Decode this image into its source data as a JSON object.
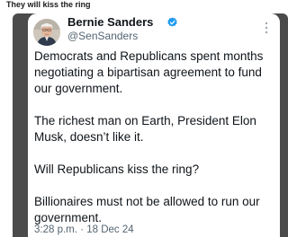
{
  "caption": "They will kiss the ring",
  "tweet": {
    "author_name": "Bernie Sanders",
    "handle": "@SenSanders",
    "paragraphs": [
      "Democrats and Republicans spent months negotiating a bipartisan agreement to fund our government.",
      "The richest man on Earth, President Elon Musk, doesn’t like it.",
      "Will Republicans kiss the ring?",
      "Billionaires must not be allowed to run our government."
    ],
    "time": "3:28 p.m.",
    "separator": "·",
    "date": "18 Dec 24"
  },
  "colors": {
    "frame": "#4b4b4b",
    "verified": "#1d9bf0",
    "text": "#0f1419",
    "muted": "#536471"
  },
  "icons": {
    "verified": "verified-badge-icon",
    "more": "more-options-icon"
  }
}
